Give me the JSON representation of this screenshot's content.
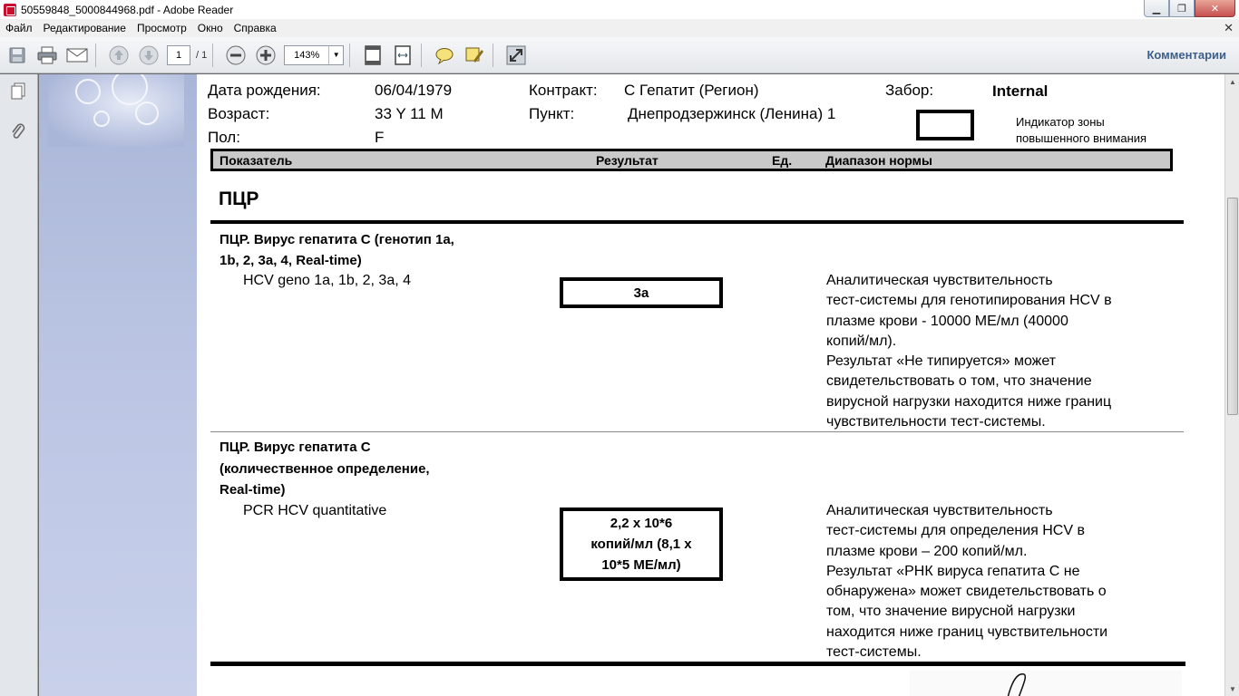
{
  "window": {
    "title": "50559848_5000844968.pdf - Adobe Reader"
  },
  "menu": {
    "items": [
      "Файл",
      "Редактирование",
      "Просмотр",
      "Окно",
      "Справка"
    ]
  },
  "toolbar": {
    "page_current": "1",
    "page_total": "/ 1",
    "zoom": "143%",
    "comments_label": "Комментарии"
  },
  "header": {
    "dob_label": "Дата рождения:",
    "dob_value": "06/04/1979",
    "age_label": "Возраст:",
    "age_value": "33 Y 11 M",
    "sex_label": "Пол:",
    "sex_value": "F",
    "contract_label": "Контракт:",
    "contract_value": "С Гепатит (Регион)",
    "point_label": "Пункт:",
    "point_value": "Днепродзержинск (Ленина) 1",
    "collection_label": "Забор:",
    "collection_value": "Internal",
    "indicator_label_1": "Индикатор зоны",
    "indicator_label_2": "повышенного внимания"
  },
  "columns": {
    "indicator": "Показатель",
    "result": "Результат",
    "units": "Ед.",
    "range": "Диапазон нормы"
  },
  "section": {
    "title": "ПЦР"
  },
  "tests": [
    {
      "name_line1": "ПЦР. Вирус гепатита С (генотип 1а,",
      "name_line2": "1b, 2, 3a, 4, Real-time)",
      "sub_name": "HCV geno 1a, 1b, 2, 3a, 4",
      "result": "3a",
      "range_lines": [
        "Аналитическая чувствительность",
        "тест-системы для генотипирования HCV в",
        "плазме крови - 10000 МЕ/мл (40000",
        "копий/мл).",
        "Результат «Не типируется» может",
        "свидетельствовать о том, что значение",
        "вирусной нагрузки находится ниже границ",
        "чувствительности тест-системы."
      ]
    },
    {
      "name_line1": "ПЦР. Вирус гепатита С",
      "name_line2": "(количественное определение,",
      "name_line3": "Real-time)",
      "sub_name": "PCR HCV quantitative",
      "result_line1": "2,2 x 10*6",
      "result_line2": "копий/мл (8,1 x",
      "result_line3": "10*5 МЕ/мл)",
      "range_lines": [
        "Аналитическая чувствительность",
        "тест-системы для определения HCV в",
        "плазме крови – 200 копий/мл.",
        "Результат «РНК вируса гепатита С не",
        "обнаружена» может свидетельствовать о",
        "том, что значение вирусной нагрузки",
        "находится ниже границ чувствительности",
        "тест-системы."
      ]
    }
  ]
}
